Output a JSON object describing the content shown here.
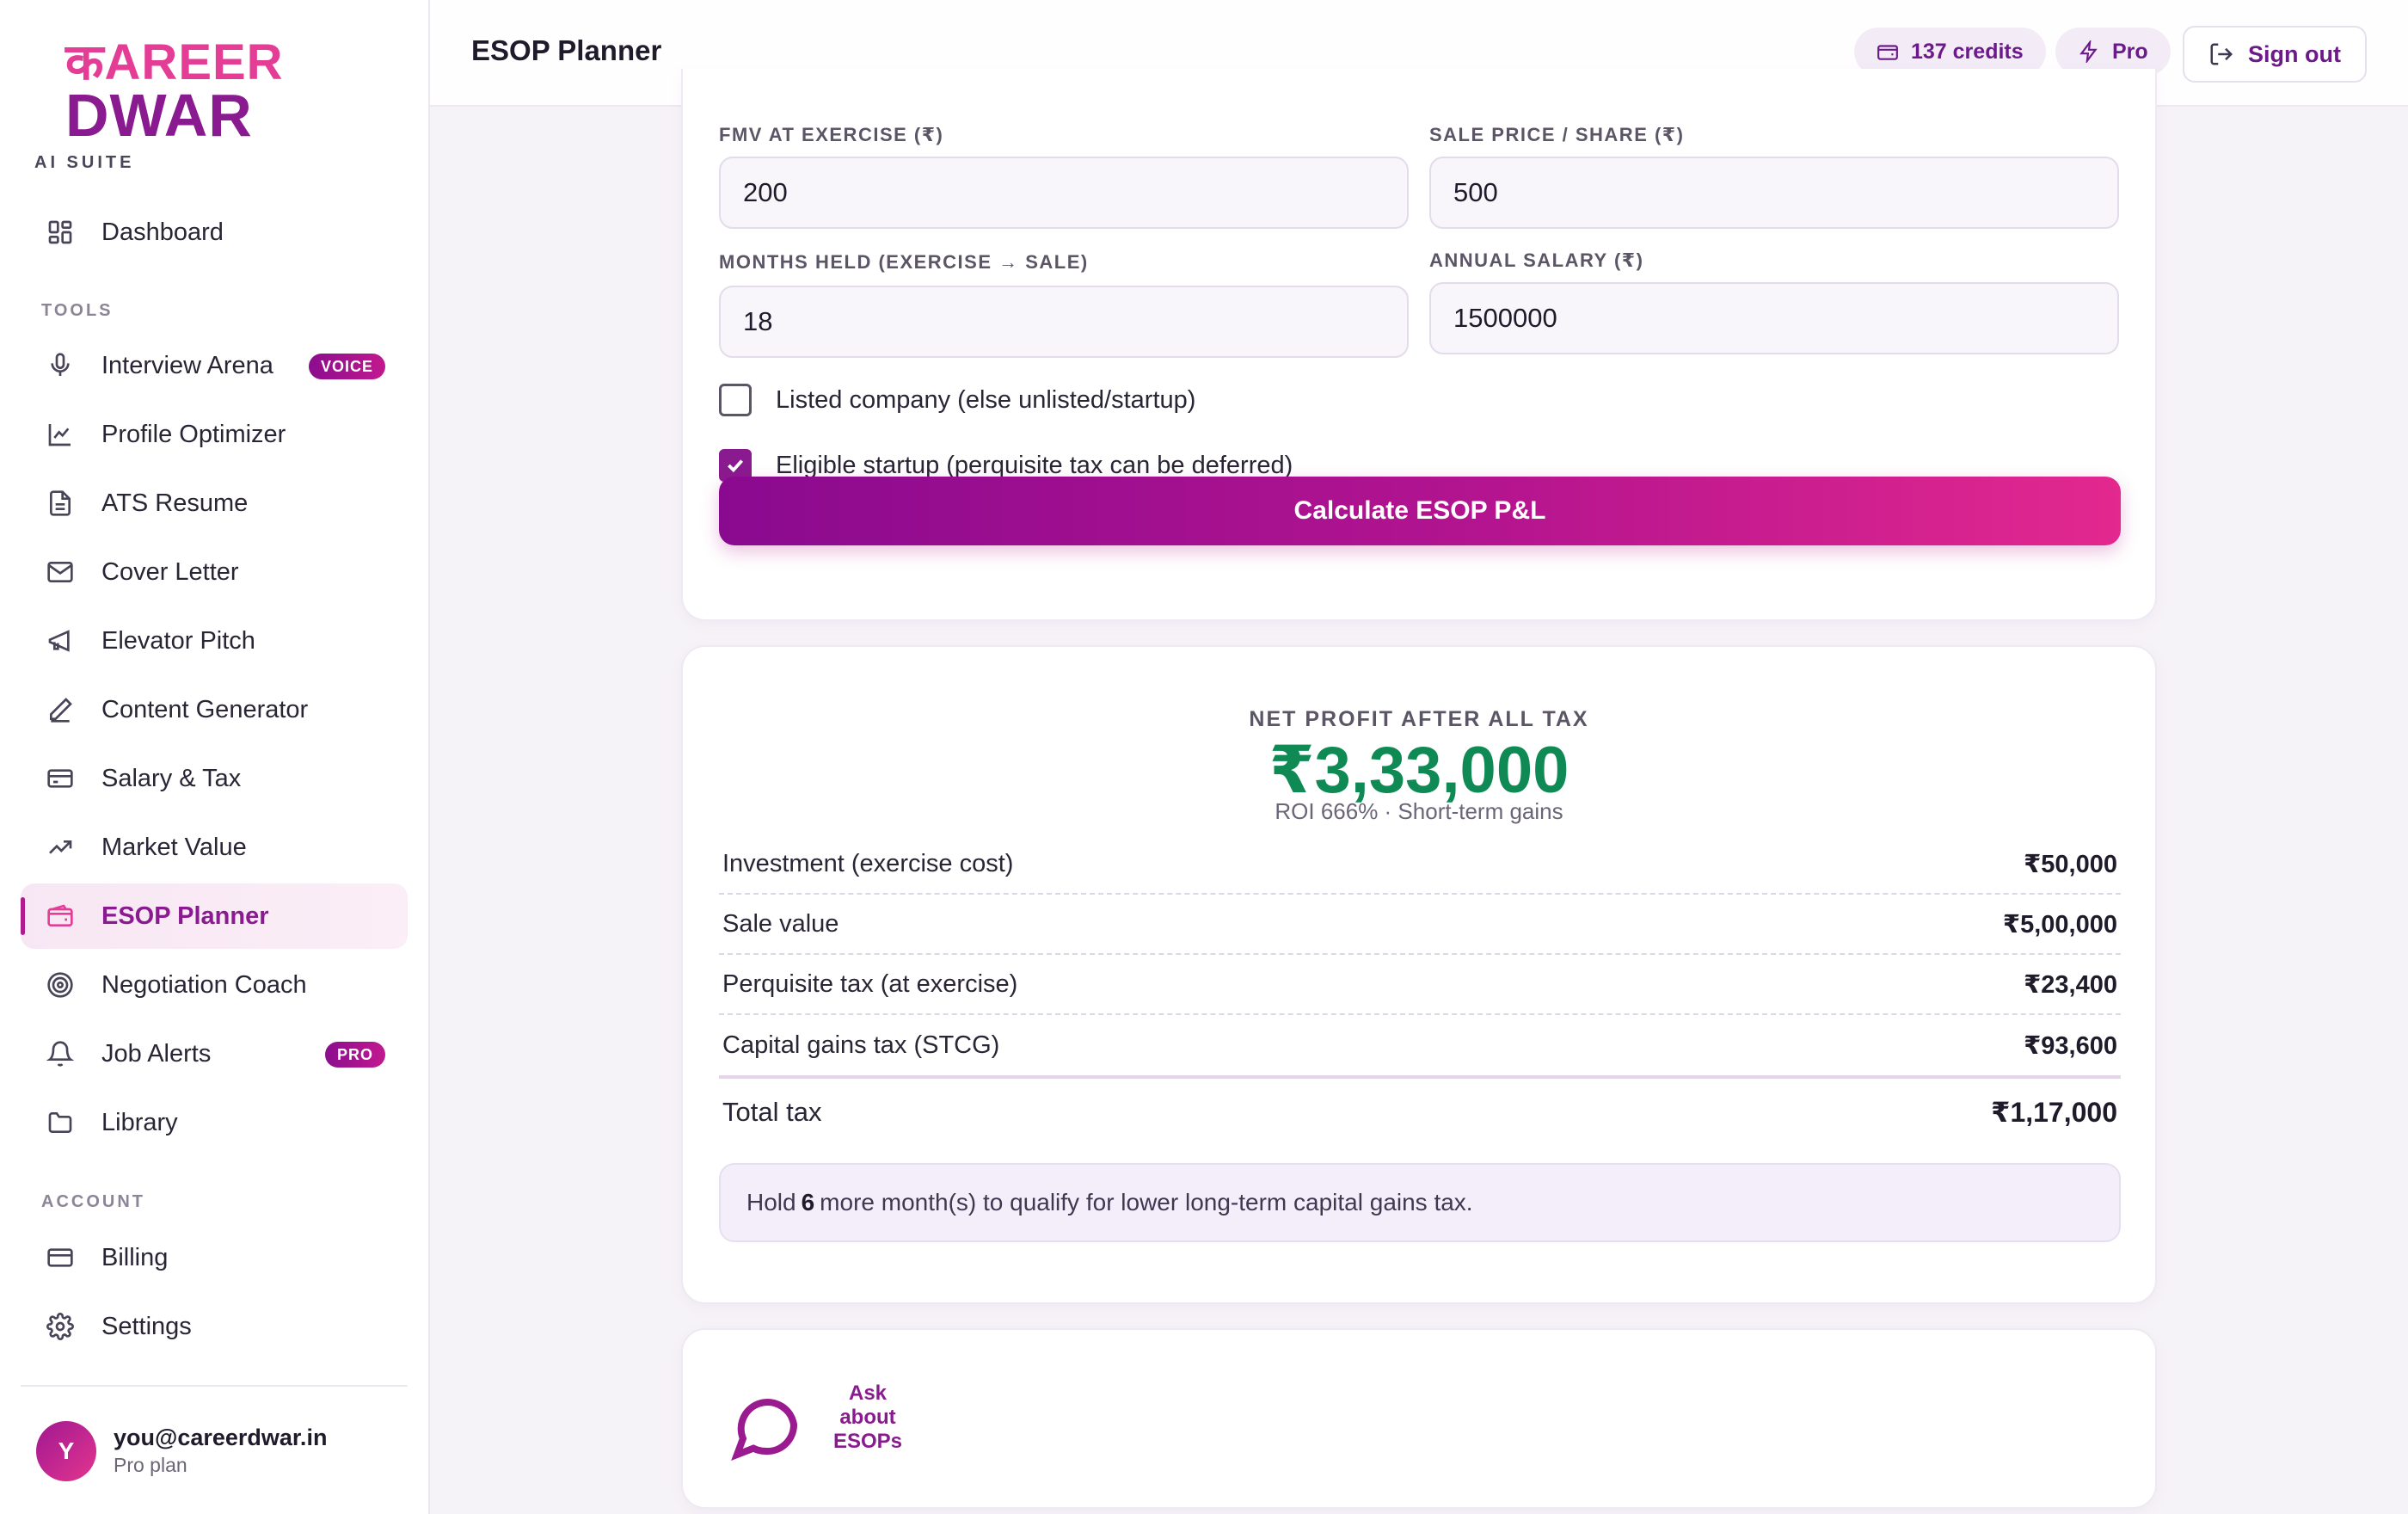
{
  "app": {
    "logo_top": "कAREER",
    "logo_bottom": "DWAR",
    "suite": "AI SUITE",
    "accent": "#8a1a8f",
    "accent_pink": "#e33d95"
  },
  "sidebar": {
    "dashboard": {
      "label": "Dashboard",
      "icon": "grid-icon"
    },
    "tools_heading": "TOOLS",
    "tools": [
      {
        "label": "Interview Arena",
        "icon": "mic-icon",
        "badge": "VOICE"
      },
      {
        "label": "Profile Optimizer",
        "icon": "line-chart-icon"
      },
      {
        "label": "ATS Resume",
        "icon": "document-icon"
      },
      {
        "label": "Cover Letter",
        "icon": "mail-icon"
      },
      {
        "label": "Elevator Pitch",
        "icon": "megaphone-icon"
      },
      {
        "label": "Content Generator",
        "icon": "pen-icon"
      },
      {
        "label": "Salary & Tax",
        "icon": "card-icon"
      },
      {
        "label": "Market Value",
        "icon": "trending-up-icon"
      },
      {
        "label": "ESOP Planner",
        "icon": "wallet-icon",
        "active": true
      },
      {
        "label": "Negotiation Coach",
        "icon": "target-icon"
      },
      {
        "label": "Job Alerts",
        "icon": "bell-icon",
        "badge": "PRO"
      },
      {
        "label": "Library",
        "icon": "folder-icon"
      }
    ],
    "account_heading": "ACCOUNT",
    "account": [
      {
        "label": "Billing",
        "icon": "card-icon"
      },
      {
        "label": "Settings",
        "icon": "gear-icon"
      }
    ],
    "user": {
      "initial": "Y",
      "email": "you@careerdwar.in",
      "plan": "Pro plan"
    }
  },
  "header": {
    "title": "ESOP Planner",
    "credits": "137 credits",
    "plan": "Pro",
    "signout": "Sign out"
  },
  "form": {
    "fmv_label": "FMV AT EXERCISE (₹)",
    "fmv_value": "200",
    "sale_label": "SALE PRICE / SHARE (₹)",
    "sale_value": "500",
    "months_label": "MONTHS HELD (EXERCISE → SALE)",
    "months_value": "18",
    "salary_label": "ANNUAL SALARY (₹)",
    "salary_value": "1500000",
    "listed_label": "Listed company (else unlisted/startup)",
    "listed_checked": false,
    "startup_label": "Eligible startup (perquisite tax can be deferred)",
    "startup_checked": true,
    "calculate_label": "Calculate ESOP P&L"
  },
  "result": {
    "label": "NET PROFIT AFTER ALL TAX",
    "value": "₹3,33,000",
    "sub": "ROI 666% · Short-term gains",
    "rows": [
      {
        "label": "Investment (exercise cost)",
        "value": "₹50,000"
      },
      {
        "label": "Sale value",
        "value": "₹5,00,000"
      },
      {
        "label": "Perquisite tax (at exercise)",
        "value": "₹23,400"
      },
      {
        "label": "Capital gains tax (STCG)",
        "value": "₹93,600"
      }
    ],
    "total": {
      "label": "Total tax",
      "value": "₹1,17,000"
    },
    "hint_pre": "Hold",
    "hint_num": "6",
    "hint_post": "more month(s) to qualify for lower long-term capital gains tax."
  },
  "ask": {
    "line1": "Ask",
    "line2": "about",
    "line3": "ESOPs"
  }
}
